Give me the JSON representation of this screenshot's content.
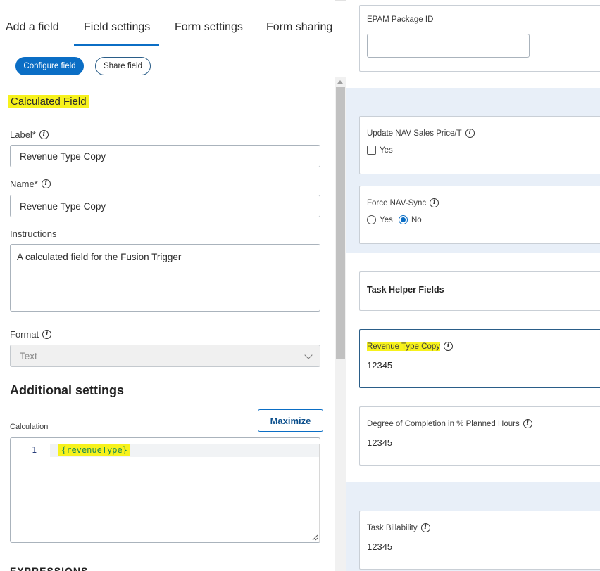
{
  "tabs": [
    {
      "label": "Add a field"
    },
    {
      "label": "Field settings"
    },
    {
      "label": "Form settings"
    },
    {
      "label": "Form sharing"
    }
  ],
  "subtabs": {
    "configure": "Configure field",
    "share": "Share field"
  },
  "field_type_title": "Calculated Field",
  "label_field": {
    "label": "Label*",
    "value": "Revenue Type Copy"
  },
  "name_field": {
    "label": "Name*",
    "value": "Revenue Type Copy"
  },
  "instructions": {
    "label": "Instructions",
    "value": "A calculated field for the Fusion Trigger"
  },
  "format": {
    "label": "Format",
    "value": "Text"
  },
  "additional_settings": {
    "heading": "Additional settings"
  },
  "calculation": {
    "label": "Calculation",
    "maximize_label": "Maximize",
    "line_number": "1",
    "code": "{revenueType}"
  },
  "expressions_heading": "EXPRESSIONS",
  "preview": {
    "epam_package": {
      "label": "EPAM Package ID",
      "value": ""
    },
    "update_nav": {
      "label": "Update NAV Sales Price/T",
      "option": "Yes"
    },
    "force_nav": {
      "label": "Force NAV-Sync",
      "options": [
        "Yes",
        "No"
      ],
      "selected": "No"
    },
    "task_helper": {
      "title": "Task Helper Fields"
    },
    "revenue_copy": {
      "label": "Revenue Type Copy",
      "value": "12345"
    },
    "degree_completion": {
      "label": "Degree of Completion in % Planned Hours",
      "value": "12345"
    },
    "task_billability": {
      "label": "Task Billability",
      "value": "12345"
    }
  },
  "colors": {
    "accent": "#0b6ec5",
    "highlight": "#f7f21c",
    "band": "#e8eff8"
  }
}
